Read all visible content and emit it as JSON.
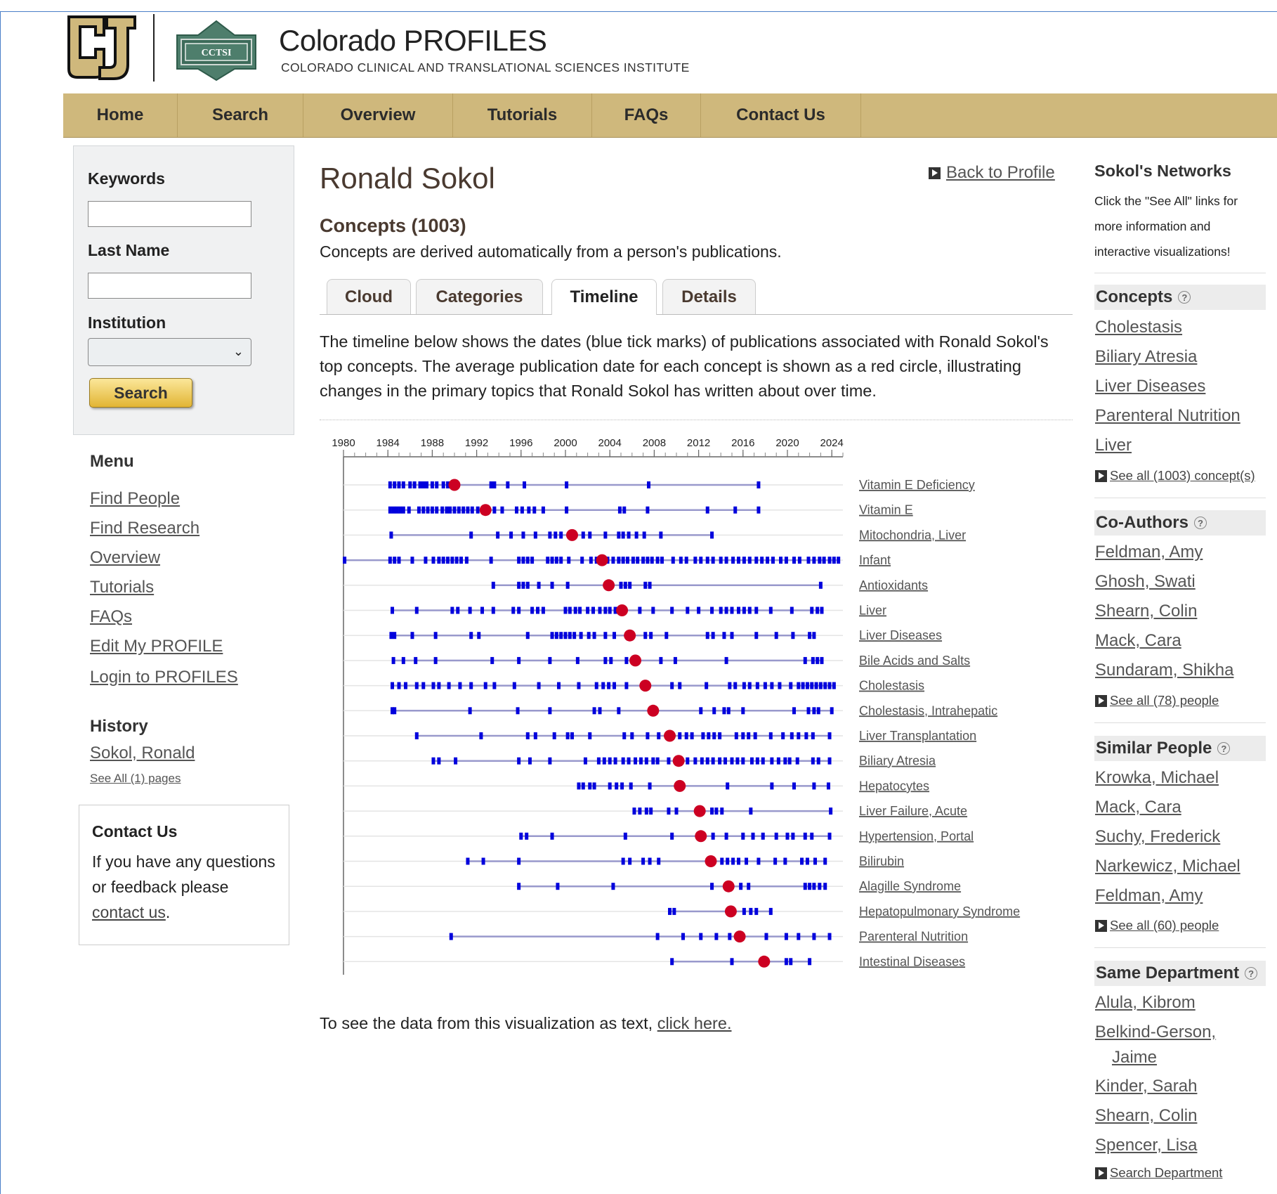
{
  "header": {
    "title": "Colorado PROFILES",
    "subtitle": "COLORADO CLINICAL AND TRANSLATIONAL SCIENCES INSTITUTE",
    "cctsi_logo_text": "CCTSI"
  },
  "nav": [
    "Home",
    "Search",
    "Overview",
    "Tutorials",
    "FAQs",
    "Contact Us"
  ],
  "search": {
    "keywords_label": "Keywords",
    "keywords_value": "",
    "lastname_label": "Last Name",
    "lastname_value": "",
    "institution_label": "Institution",
    "institution_value": "",
    "button": "Search"
  },
  "menu": {
    "title": "Menu",
    "items": [
      "Find People",
      "Find Research",
      "Overview",
      "Tutorials",
      "FAQs",
      "Edit My PROFILE",
      "Login to PROFILES"
    ]
  },
  "history": {
    "title": "History",
    "item": "Sokol, Ronald",
    "see_all": "See All (1) pages"
  },
  "contact": {
    "title": "Contact Us",
    "text": "If you have any questions or feedback please",
    "link": "contact us",
    "period": "."
  },
  "main": {
    "person": "Ronald Sokol",
    "back": "Back to Profile",
    "heading": "Concepts (1003)",
    "desc": "Concepts are derived automatically from a person's publications.",
    "tabs": [
      "Cloud",
      "Categories",
      "Timeline",
      "Details"
    ],
    "active_tab": "Timeline",
    "intro": "The timeline below shows the dates (blue tick marks) of publications associated with Ronald Sokol's top concepts. The average publication date for each concept is shown as a red circle, illustrating changes in the primary topics that Ronald Sokol has written about over time.",
    "footnote": "To see the data from this visualization as text,",
    "footnote_link": "click here."
  },
  "chart_data": {
    "type": "timeline",
    "x_ticks": [
      1980,
      1984,
      1988,
      1992,
      1996,
      2000,
      2004,
      2008,
      2012,
      2016,
      2020,
      2024
    ],
    "x_range": [
      1980,
      2025
    ],
    "tick_color": "#0000dd",
    "line_color": "#9999cc",
    "avg_color": "#cc0022",
    "concepts": [
      {
        "name": "Vitamin E Deficiency",
        "avg": 1990.0,
        "years": [
          1984.2,
          1984.6,
          1985.0,
          1985.4,
          1986.0,
          1986.4,
          1986.9,
          1987.2,
          1987.5,
          1988.0,
          1988.4,
          1989.0,
          1989.4,
          1990.2,
          1993.3,
          1993.6,
          1994.8,
          1996.3,
          2000.1,
          2007.5,
          2017.4
        ]
      },
      {
        "name": "Vitamin E",
        "avg": 1992.8,
        "years": [
          1984.2,
          1984.5,
          1984.8,
          1985.1,
          1985.4,
          1985.9,
          1986.8,
          1987.2,
          1987.6,
          1988.0,
          1988.4,
          1988.9,
          1989.3,
          1989.6,
          1990.0,
          1990.4,
          1990.8,
          1991.2,
          1991.6,
          1992.1,
          1993.6,
          1994.3,
          1995.6,
          1996.1,
          1996.7,
          1997.2,
          1998.0,
          2000.1,
          2004.9,
          2005.3,
          2007.4,
          2012.8,
          2015.3,
          2017.4
        ]
      },
      {
        "name": "Mitochondria, Liver",
        "avg": 2000.6,
        "years": [
          1984.3,
          1991.5,
          1993.9,
          1995.1,
          1996.2,
          1997.3,
          1998.6,
          1999.1,
          1999.6,
          2001.6,
          2002.2,
          2003.6,
          2004.8,
          2005.2,
          2005.7,
          2006.4,
          2007.1,
          2008.6,
          2013.2
        ]
      },
      {
        "name": "Infant",
        "avg": 2003.3,
        "years": [
          1980.1,
          1984.2,
          1984.6,
          1985.0,
          1986.2,
          1987.4,
          1988.1,
          1988.6,
          1989.0,
          1989.4,
          1989.8,
          1990.2,
          1990.6,
          1991.1,
          1993.3,
          1995.8,
          1996.2,
          1996.6,
          1997.0,
          1998.4,
          1998.8,
          1999.2,
          1999.6,
          2000.3,
          2001.5,
          2002.3,
          2002.8,
          2003.3,
          2003.8,
          2004.3,
          2004.8,
          2005.2,
          2005.6,
          2006.1,
          2006.5,
          2007.0,
          2007.4,
          2007.8,
          2008.3,
          2008.7,
          2009.7,
          2010.4,
          2010.9,
          2011.7,
          2012.2,
          2012.8,
          2013.3,
          2014.0,
          2014.5,
          2015.1,
          2015.6,
          2016.1,
          2016.6,
          2017.2,
          2017.7,
          2018.2,
          2018.7,
          2019.4,
          2019.9,
          2020.6,
          2021.1,
          2021.9,
          2022.4,
          2022.9,
          2023.3,
          2023.8,
          2024.2,
          2024.6
        ]
      },
      {
        "name": "Antioxidants",
        "avg": 2003.9,
        "years": [
          1993.5,
          1995.8,
          1996.2,
          1996.6,
          1997.6,
          1998.8,
          2000.2,
          2003.9,
          2005.0,
          2005.4,
          2005.8,
          2007.2,
          2007.6,
          2023.0
        ]
      },
      {
        "name": "Liver",
        "avg": 2005.1,
        "years": [
          1984.4,
          1986.6,
          1989.8,
          1990.3,
          1991.4,
          1992.5,
          1993.5,
          1995.3,
          1995.8,
          1997.0,
          1997.5,
          1998.0,
          2000.0,
          2000.4,
          2000.9,
          2001.3,
          2002.0,
          2002.5,
          2003.1,
          2003.6,
          2004.0,
          2004.5,
          2005.1,
          2006.7,
          2007.9,
          2009.6,
          2011.0,
          2012.0,
          2013.2,
          2014.0,
          2014.5,
          2015.0,
          2015.6,
          2016.1,
          2016.6,
          2017.2,
          2018.5,
          2020.4,
          2022.2,
          2022.7,
          2023.1
        ]
      },
      {
        "name": "Liver Diseases",
        "avg": 2005.8,
        "years": [
          1984.3,
          1984.6,
          1986.2,
          1988.3,
          1991.5,
          1992.2,
          1996.6,
          1998.8,
          1999.2,
          1999.6,
          2000.0,
          2000.4,
          2000.8,
          2001.4,
          2002.1,
          2002.6,
          2003.6,
          2004.4,
          2005.8,
          2007.2,
          2007.7,
          2009.1,
          2012.8,
          2013.3,
          2014.3,
          2015.0,
          2017.2,
          2019.0,
          2020.5,
          2022.0,
          2022.4
        ]
      },
      {
        "name": "Bile Acids and Salts",
        "avg": 2006.3,
        "years": [
          1984.5,
          1985.4,
          1986.5,
          1988.3,
          1993.4,
          1995.8,
          1998.6,
          2001.1,
          2003.6,
          2004.1,
          2005.5,
          2006.3,
          2008.6,
          2009.9,
          2014.5,
          2021.6,
          2022.3,
          2022.7,
          2023.1
        ]
      },
      {
        "name": "Cholestasis",
        "avg": 2007.2,
        "years": [
          1984.4,
          1985.0,
          1985.6,
          1986.6,
          1987.2,
          1988.1,
          1988.6,
          1989.5,
          1990.5,
          1991.5,
          1992.8,
          1993.6,
          1995.4,
          1997.6,
          1999.4,
          2001.2,
          2002.8,
          2003.4,
          2003.9,
          2004.4,
          2005.5,
          2007.2,
          2009.6,
          2010.3,
          2012.7,
          2014.8,
          2015.3,
          2016.1,
          2016.6,
          2017.3,
          2018.0,
          2018.6,
          2019.3,
          2020.3,
          2021.0,
          2021.4,
          2021.8,
          2022.2,
          2022.6,
          2023.0,
          2023.4,
          2023.8,
          2024.2
        ]
      },
      {
        "name": "Cholestasis, Intrahepatic",
        "avg": 2007.9,
        "years": [
          1984.4,
          1984.6,
          1991.4,
          1995.7,
          1998.6,
          2002.6,
          2003.1,
          2004.8,
          2007.9,
          2012.2,
          2013.4,
          2014.3,
          2014.7,
          2016.0,
          2020.6,
          2021.9,
          2022.4,
          2022.8,
          2024.0
        ]
      },
      {
        "name": "Liver Transplantation",
        "avg": 2009.4,
        "years": [
          1986.6,
          1992.4,
          1996.6,
          1997.3,
          1999.0,
          2000.2,
          2000.6,
          2002.2,
          2005.3,
          2006.0,
          2007.4,
          2008.4,
          2009.4,
          2010.3,
          2010.9,
          2011.4,
          2012.4,
          2012.9,
          2013.4,
          2013.9,
          2015.4,
          2016.0,
          2016.5,
          2017.1,
          2018.5,
          2019.6,
          2020.4,
          2021.0,
          2021.7,
          2022.3,
          2023.8
        ]
      },
      {
        "name": "Biliary Atresia",
        "avg": 2010.2,
        "years": [
          1988.1,
          1988.6,
          1990.1,
          1995.8,
          1996.8,
          1998.6,
          2001.8,
          2003.0,
          2003.5,
          2004.0,
          2004.5,
          2005.2,
          2005.7,
          2006.3,
          2006.8,
          2007.3,
          2007.9,
          2008.3,
          2009.3,
          2010.2,
          2011.0,
          2011.7,
          2012.3,
          2012.8,
          2013.3,
          2013.9,
          2014.4,
          2015.0,
          2015.5,
          2016.0,
          2016.8,
          2017.3,
          2017.8,
          2018.6,
          2019.2,
          2019.8,
          2020.2,
          2020.9,
          2022.3,
          2022.8,
          2023.8
        ]
      },
      {
        "name": "Hepatocytes",
        "avg": 2010.3,
        "years": [
          2001.2,
          2001.6,
          2002.2,
          2002.6,
          2004.0,
          2004.6,
          2005.1,
          2005.9,
          2007.6,
          2010.3,
          2014.6,
          2018.6,
          2020.6,
          2022.4,
          2023.7
        ]
      },
      {
        "name": "Liver Failure, Acute",
        "avg": 2012.1,
        "years": [
          2006.2,
          2006.7,
          2007.3,
          2007.7,
          2009.3,
          2010.0,
          2012.1,
          2013.2,
          2013.6,
          2014.1,
          2016.7,
          2023.9
        ]
      },
      {
        "name": "Hypertension, Portal",
        "avg": 2012.2,
        "years": [
          1996.0,
          1996.5,
          1998.8,
          2005.4,
          2009.6,
          2012.2,
          2013.3,
          2014.5,
          2016.0,
          2016.9,
          2017.8,
          2019.0,
          2020.0,
          2020.5,
          2021.6,
          2022.2,
          2023.8
        ]
      },
      {
        "name": "Bilirubin",
        "avg": 2013.1,
        "years": [
          1991.2,
          1992.6,
          1995.8,
          2005.2,
          2005.8,
          2007.0,
          2007.6,
          2008.4,
          2013.1,
          2014.1,
          2014.6,
          2015.1,
          2015.6,
          2016.3,
          2017.4,
          2018.9,
          2019.8,
          2021.3,
          2021.8,
          2022.5,
          2023.4
        ]
      },
      {
        "name": "Alagille Syndrome",
        "avg": 2014.7,
        "years": [
          1995.8,
          1999.3,
          2004.3,
          2013.2,
          2014.7,
          2015.8,
          2016.5,
          2021.6,
          2022.0,
          2022.4,
          2022.9,
          2023.4
        ]
      },
      {
        "name": "Hepatopulmonary Syndrome",
        "avg": 2014.9,
        "years": [
          2009.4,
          2009.8,
          2014.9,
          2016.1,
          2016.7,
          2017.2,
          2018.5
        ]
      },
      {
        "name": "Parenteral Nutrition",
        "avg": 2015.7,
        "years": [
          1989.7,
          2008.3,
          2010.6,
          2012.2,
          2013.6,
          2014.8,
          2015.7,
          2018.1,
          2019.9,
          2021.0,
          2022.4,
          2023.8
        ]
      },
      {
        "name": "Intestinal Diseases",
        "avg": 2017.9,
        "years": [
          2009.6,
          2015.0,
          2017.9,
          2019.9,
          2020.3,
          2022.0
        ]
      }
    ]
  },
  "sidebar": {
    "networks_title": "Sokol's Networks",
    "networks_desc": "Click the \"See All\" links for more information and interactive visualizations!",
    "concepts": {
      "title": "Concepts",
      "items": [
        "Cholestasis",
        "Biliary Atresia",
        "Liver Diseases",
        "Parenteral Nutrition",
        "Liver"
      ],
      "see_all": "See all (1003) concept(s)"
    },
    "coauthors": {
      "title": "Co-Authors",
      "items": [
        "Feldman, Amy",
        "Ghosh, Swati",
        "Shearn, Colin",
        "Mack, Cara",
        "Sundaram, Shikha"
      ],
      "see_all": "See all (78) people"
    },
    "similar": {
      "title": "Similar People",
      "items": [
        "Krowka, Michael",
        "Mack, Cara",
        "Suchy, Frederick",
        "Narkewicz, Michael",
        "Feldman, Amy"
      ],
      "see_all": "See all (60) people"
    },
    "department": {
      "title": "Same Department",
      "items": [
        "Alula, Kibrom",
        "Belkind-Gerson,",
        "Jaime",
        "Kinder, Sarah",
        "Shearn, Colin",
        "Spencer, Lisa"
      ],
      "see_all": "Search Department"
    }
  }
}
